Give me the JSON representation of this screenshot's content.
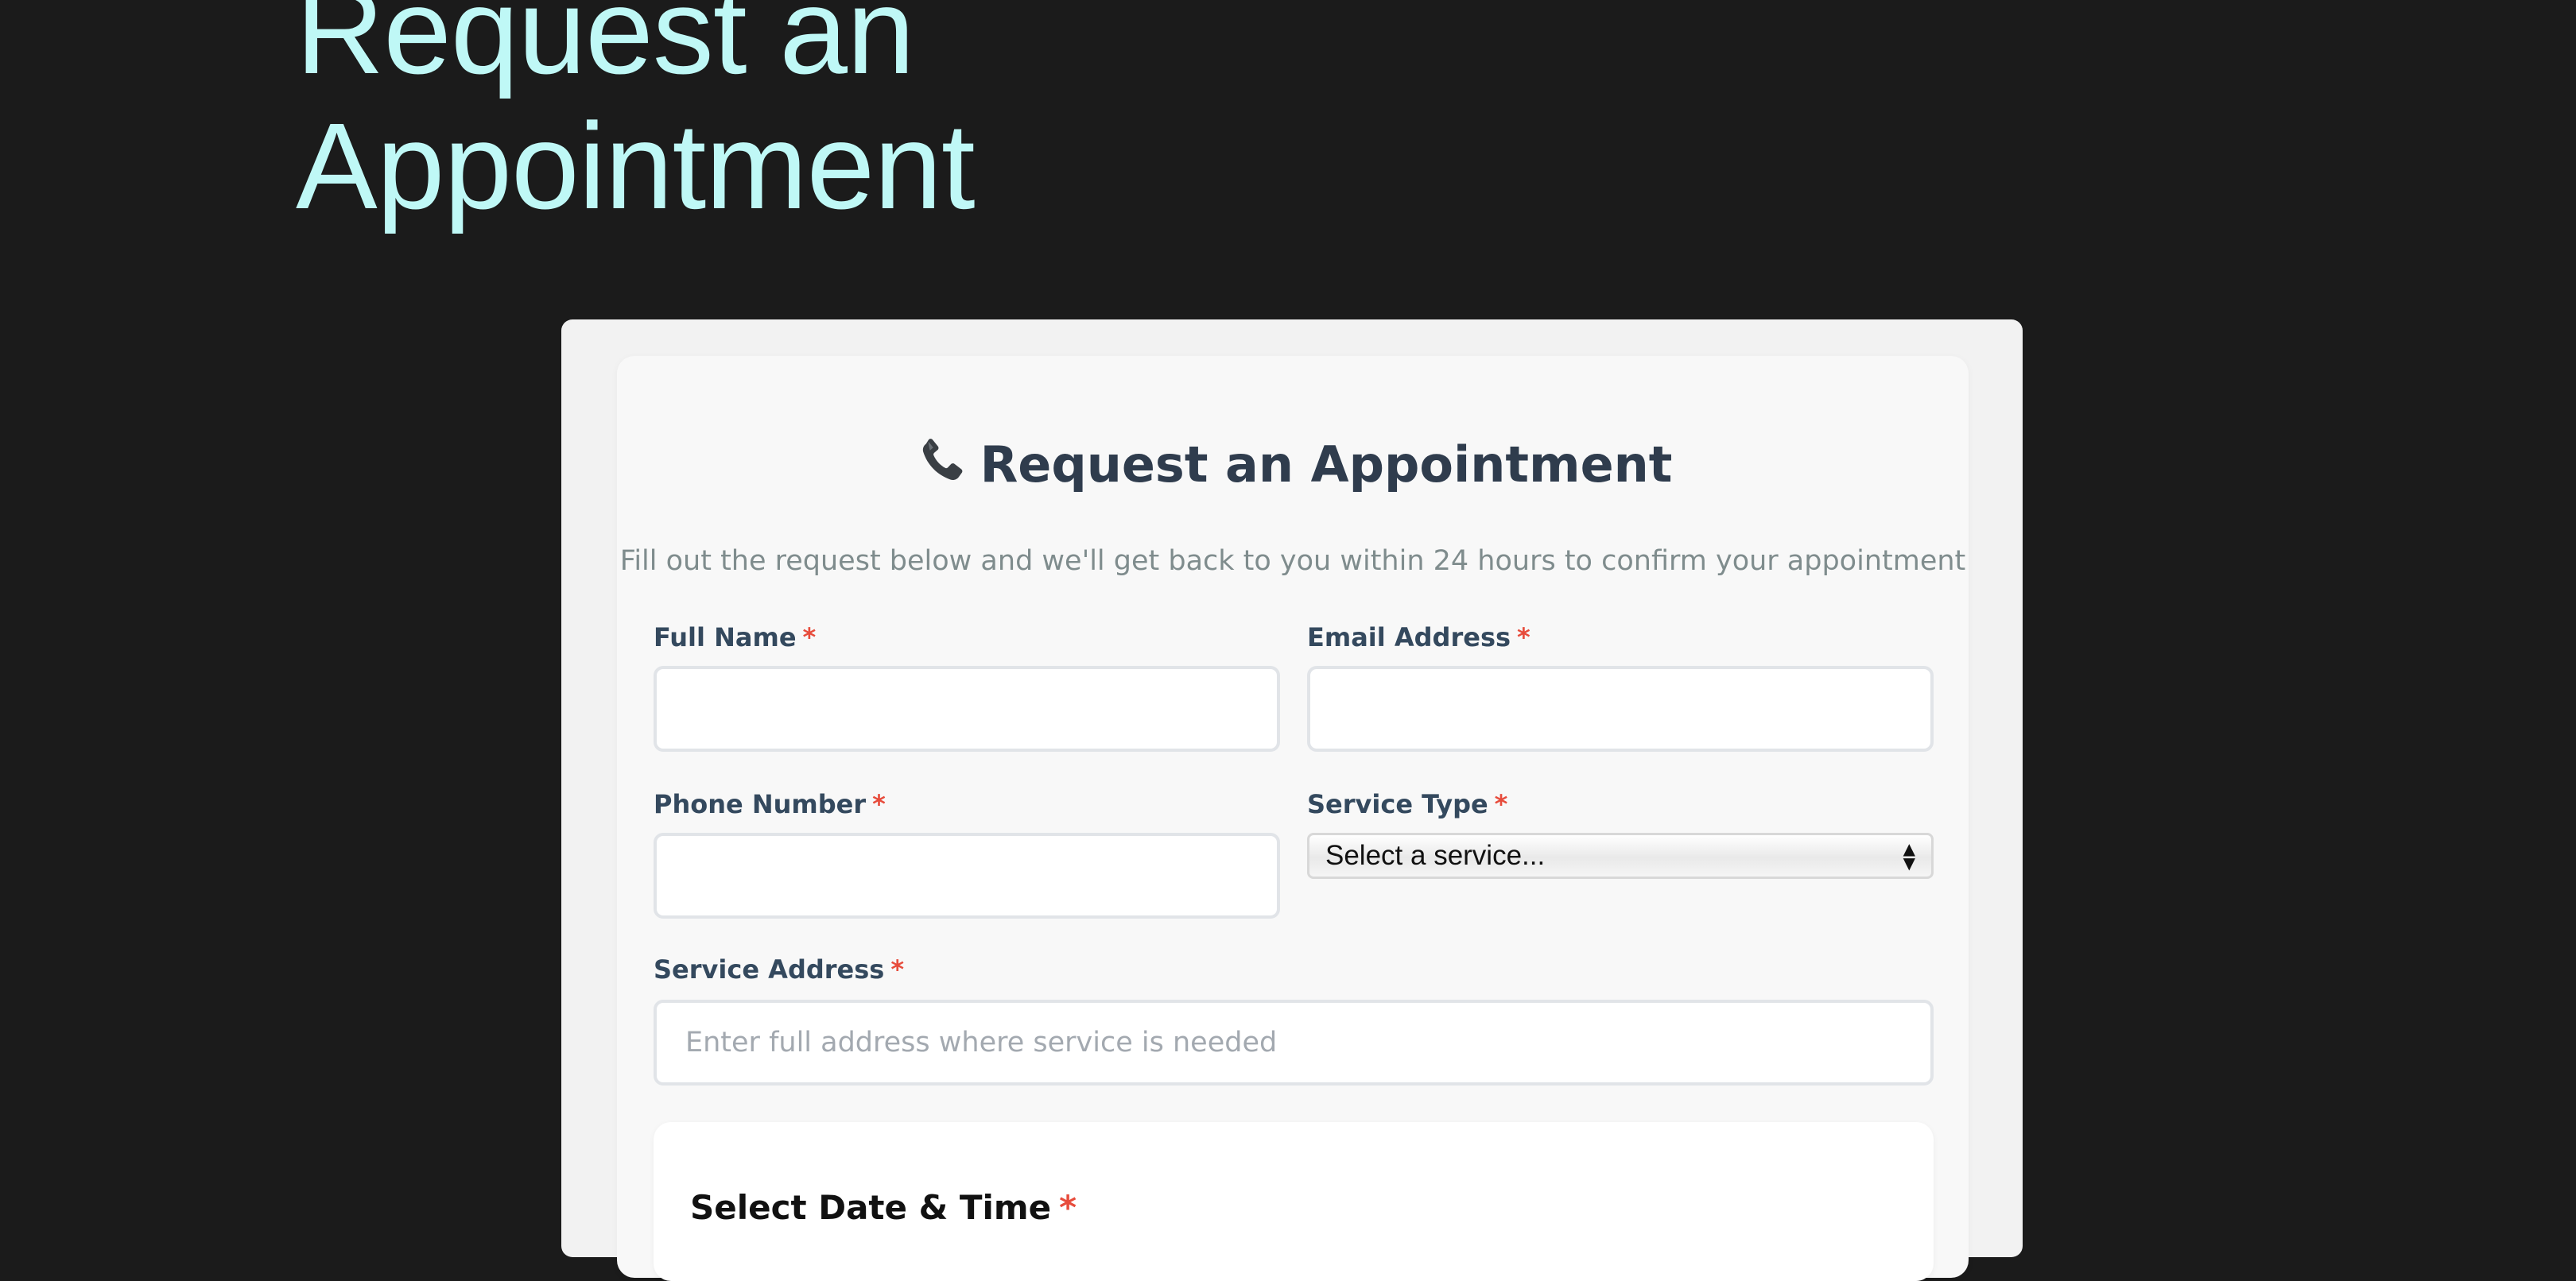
{
  "page": {
    "hero_title": "Request an Appointment"
  },
  "form": {
    "heading": "Request an Appointment",
    "heading_icon": "phone-icon",
    "subtitle": "Fill out the request below and we'll get back to you within 24 hours to confirm your appointment",
    "required_mark": "*",
    "fields": {
      "full_name": {
        "label": "Full Name",
        "value": "",
        "placeholder": ""
      },
      "email": {
        "label": "Email Address",
        "value": "",
        "placeholder": ""
      },
      "phone": {
        "label": "Phone Number",
        "value": "",
        "placeholder": ""
      },
      "service_type": {
        "label": "Service Type",
        "selected": "Select a service..."
      },
      "service_address": {
        "label": "Service Address",
        "value": "",
        "placeholder": "Enter full address where service is needed"
      }
    },
    "datetime": {
      "heading": "Select Date & Time"
    }
  },
  "colors": {
    "background": "#1b1b1b",
    "hero_title": "#bff8f6",
    "heading_text": "#2f3c4d",
    "label_text": "#34495e",
    "subtitle_text": "#7f8c8d",
    "required": "#e74c3c"
  }
}
